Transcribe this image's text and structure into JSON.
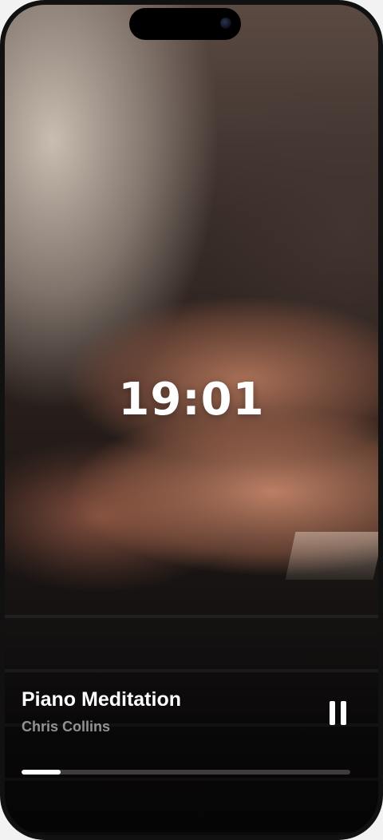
{
  "lock_screen": {
    "time": "19:01"
  },
  "now_playing": {
    "title": "Piano Meditation",
    "artist": "Chris Collins",
    "state": "playing",
    "control_icon": "pause-icon",
    "progress": 0.12
  },
  "colors": {
    "text_primary": "#ffffff",
    "text_secondary": "rgba(255,255,255,0.55)",
    "progress_track": "rgba(255,255,255,0.22)",
    "progress_fill": "#ffffff"
  }
}
